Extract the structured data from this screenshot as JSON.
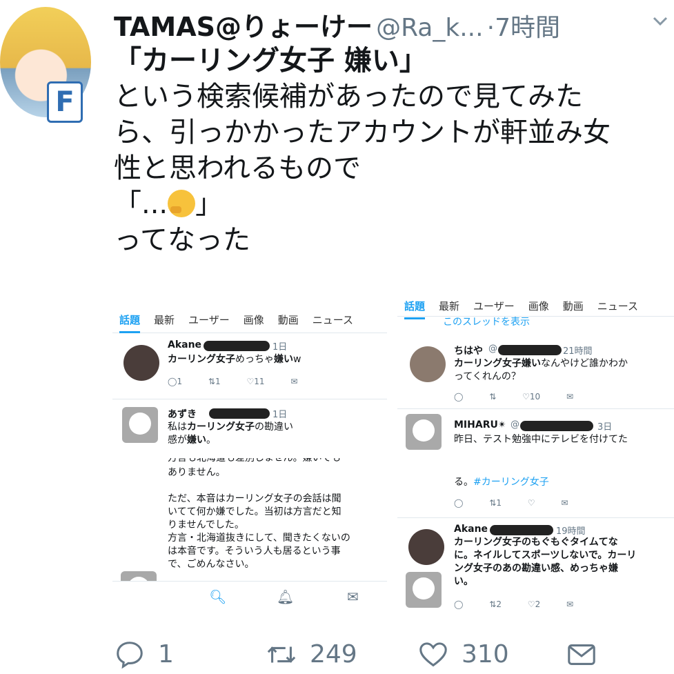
{
  "tweet": {
    "display_name": "TAMAS@りょーけー",
    "handle": "@Ra_k...",
    "separator": "·",
    "time": "7時間",
    "lines": [
      "「カーリング女子 嫌い」",
      "という検索候補があったので見てみた",
      "ら、引っかかったアカウントが軒並み女",
      "性と思われるもので",
      "「...",
      "」",
      "ってなった"
    ],
    "avatar_badge": "F",
    "icons": {
      "caret": "chevron-down-icon",
      "thinking": "thinking-face-emoji"
    }
  },
  "screenshots": {
    "tabs": [
      "話題",
      "最新",
      "ユーザー",
      "画像",
      "動画",
      "ニュース"
    ],
    "left_top": {
      "rows": [
        {
          "name": "Akane",
          "time": "1日",
          "text_a": "カーリング女子",
          "text_b": "めっちゃ",
          "text_c": "嫌い",
          "text_d": "w",
          "reply": "1",
          "rt": "1",
          "like": "11"
        },
        {
          "name": "あずき",
          "time": "1日",
          "line1_a": "私は",
          "line1_b": "カーリング女子",
          "line1_c": "の勘違い",
          "line2_a": "感が",
          "line2_b": "嫌い",
          "line2_c": "。"
        }
      ]
    },
    "left_bottom": {
      "cut_line": "方言も北海道も差別しません。嫌いでも",
      "lines": [
        "ありません。",
        "",
        "ただ、本音はカーリング女子の会話は聞",
        "いてて何か嫌でした。当初は方言だと知",
        "りませんでした。",
        "方言・北海道抜きにして、聞きたくないの",
        "は本音です。そういう人も居るという事",
        "で、ごめんなさい。"
      ]
    },
    "right_top": {
      "cut_line": "このスレッドを表示",
      "rows": [
        {
          "name": "ちはや",
          "at": "@",
          "time": "21時間",
          "line1_a": "カーリング女子嫌い",
          "line1_b": "なんやけど誰かわか",
          "line2": "ってくれんの？",
          "like": "10"
        },
        {
          "name": "MIHARU✴",
          "at": "@",
          "time": "3日",
          "line1": "昨日、テスト勉強中にテレビを付けてた"
        }
      ]
    },
    "right_bottom": {
      "top_line_a": "る。",
      "top_line_b": "#カーリング女子",
      "rt_top": "1",
      "row": {
        "name": "Akane",
        "time": "19時間",
        "lines": [
          "カーリング女子のもぐもぐタイムてな",
          "に。ネイルしてスポーツしないで。カーリ",
          "ング女子のあの勘違い感、めっちゃ嫌",
          "い。"
        ],
        "rt": "2",
        "like": "2"
      }
    }
  },
  "stats": {
    "replies": "1",
    "retweets": "249",
    "likes": "310"
  },
  "colors": {
    "link": "#1da1f2",
    "muted": "#657786",
    "text": "#14171a"
  }
}
